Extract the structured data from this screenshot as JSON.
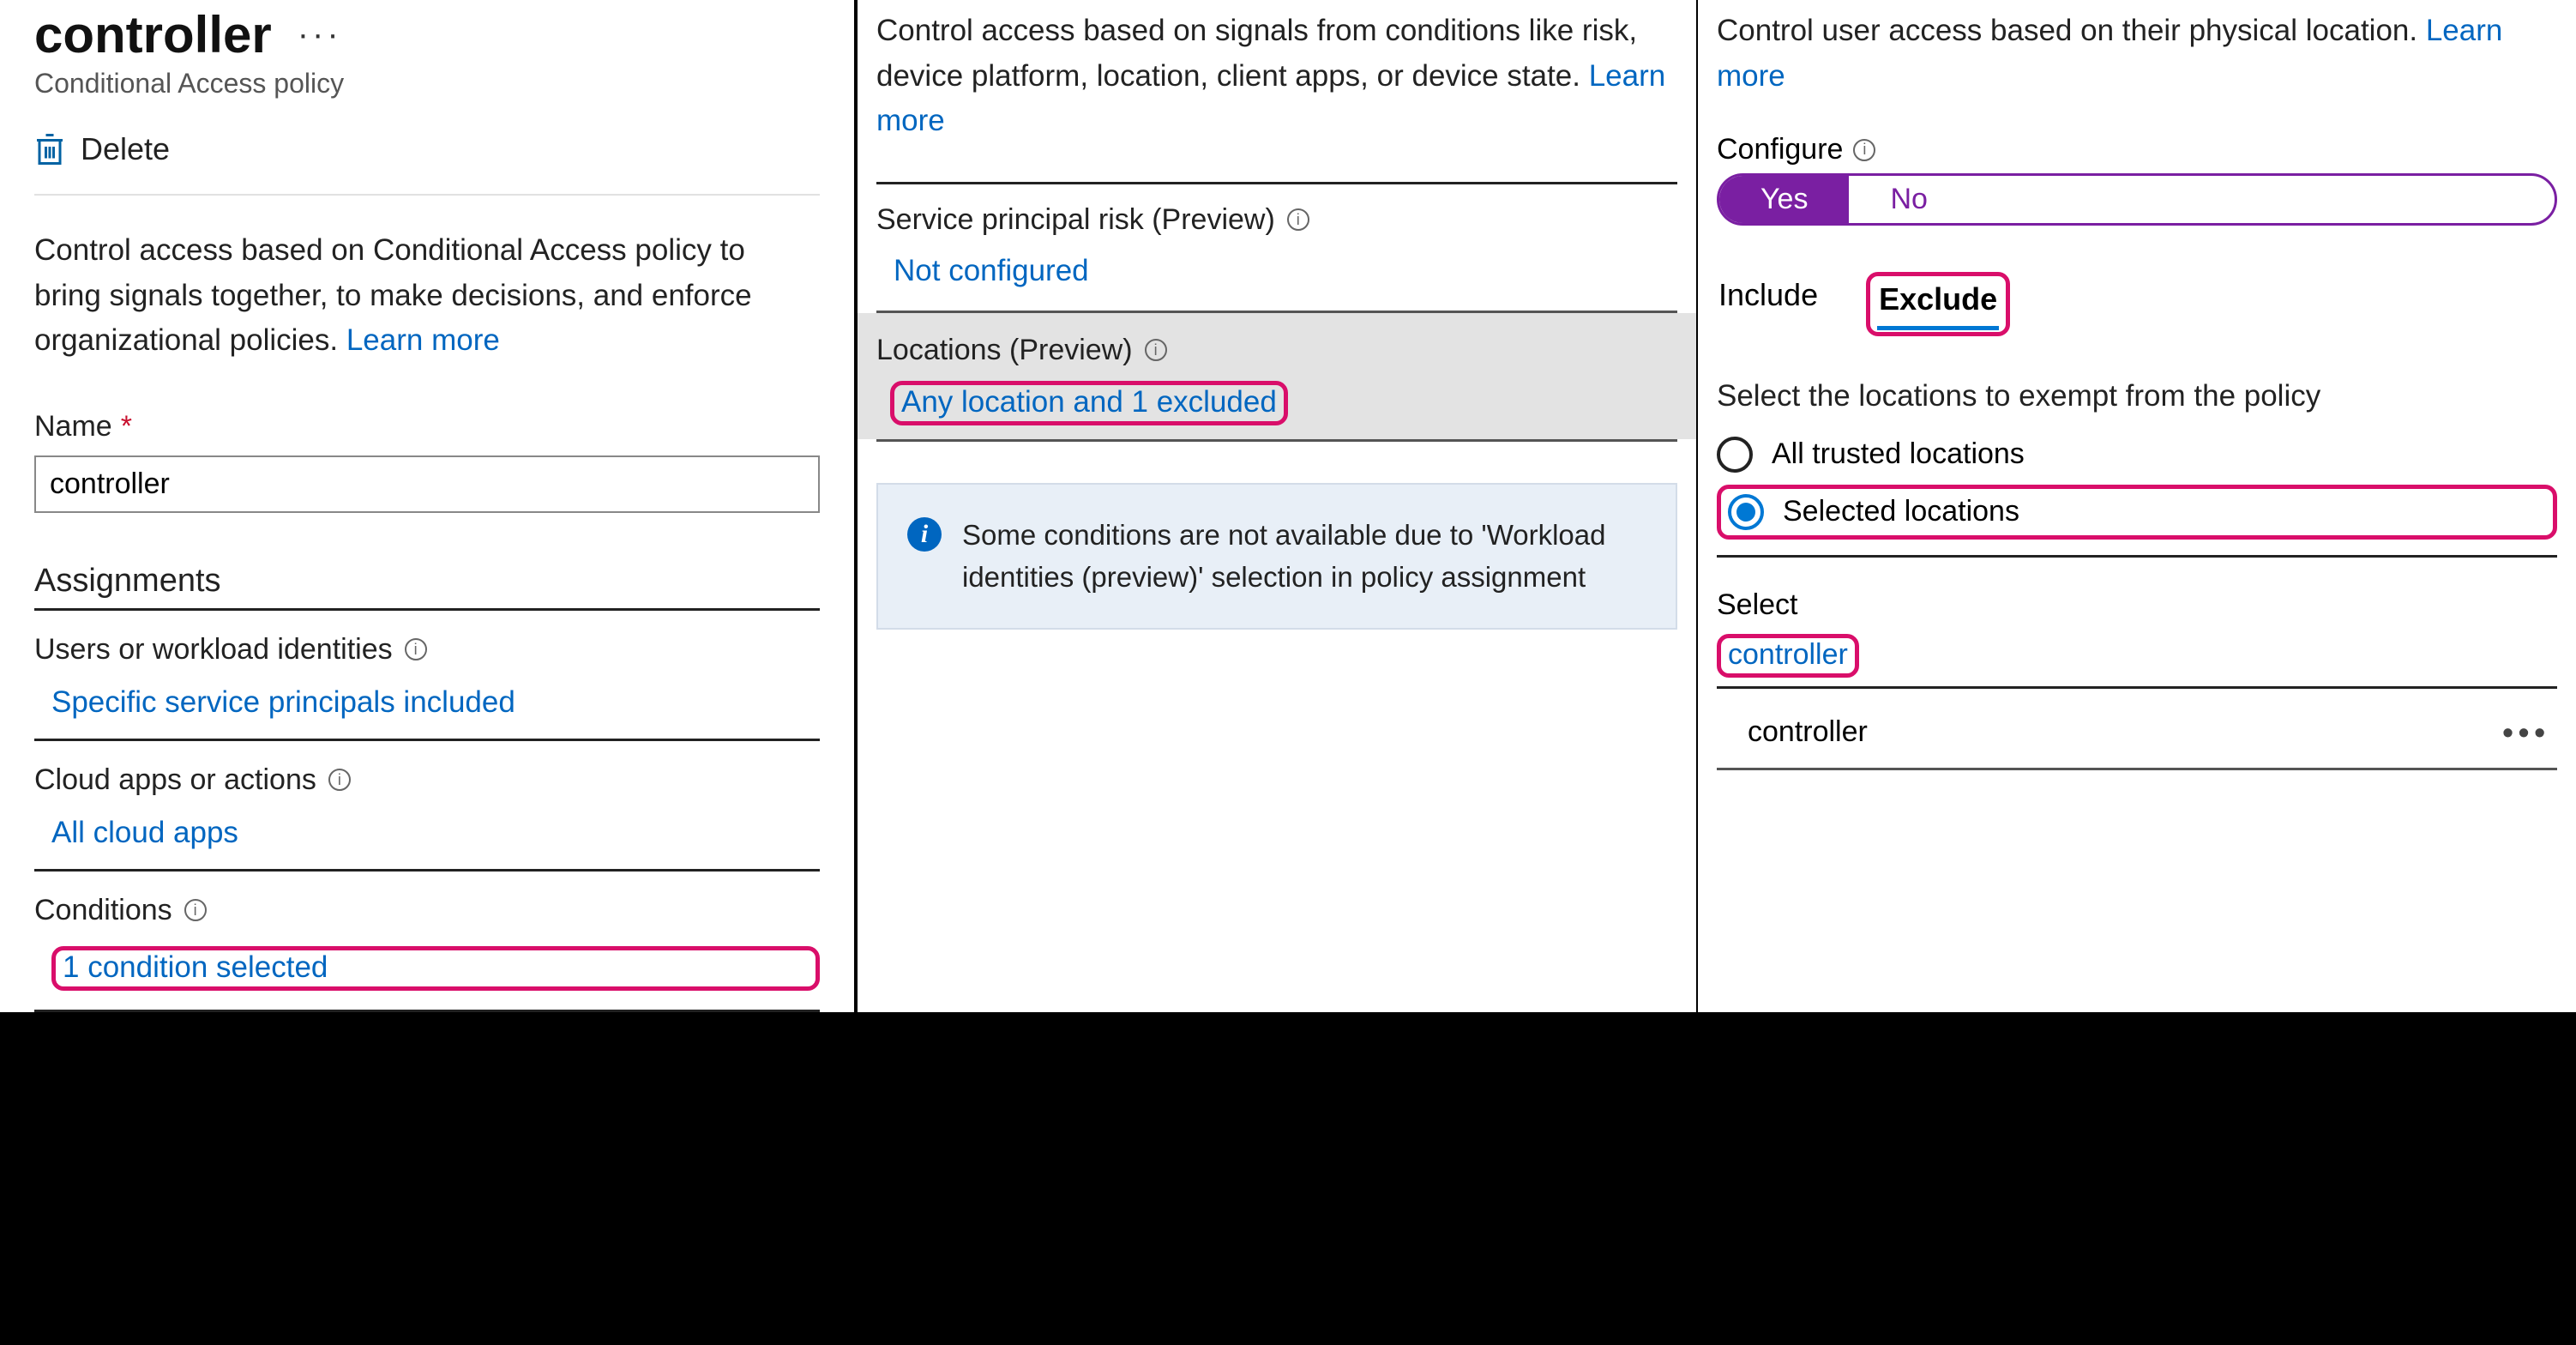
{
  "col1": {
    "title": "controller",
    "more": "···",
    "subtitle": "Conditional Access policy",
    "delete_label": "Delete",
    "body": "Control access based on Conditional Access policy to bring signals together, to make decisions, and enforce organizational policies.",
    "learn_more": "Learn more",
    "name_label": "Name",
    "required": "*",
    "name_value": "controller",
    "assignments_hdr": "Assignments",
    "users_label": "Users or workload identities",
    "users_value": "Specific service principals included",
    "apps_label": "Cloud apps or actions",
    "apps_value": "All cloud apps",
    "cond_label": "Conditions",
    "cond_value": "1 condition selected"
  },
  "col2": {
    "body": "Control access based on signals from conditions like risk, device platform, location, client apps, or device state.",
    "learn_more": "Learn more",
    "spr_label": "Service principal risk (Preview)",
    "spr_value": "Not configured",
    "loc_label": "Locations (Preview)",
    "loc_value": "Any location and 1 excluded",
    "info_text": "Some conditions are not available due to 'Workload identities (preview)' selection in policy assignment"
  },
  "col3": {
    "body": "Control user access based on their physical location.",
    "learn_more": "Learn more",
    "config_label": "Configure",
    "toggle_yes": "Yes",
    "toggle_no": "No",
    "tab_include": "Include",
    "tab_exclude": "Exclude",
    "exempt_text": "Select the locations to exempt from the policy",
    "radio_all": "All trusted locations",
    "radio_sel": "Selected locations",
    "select_label": "Select",
    "select_value": "controller",
    "list_item": "controller",
    "list_more": "•••"
  }
}
